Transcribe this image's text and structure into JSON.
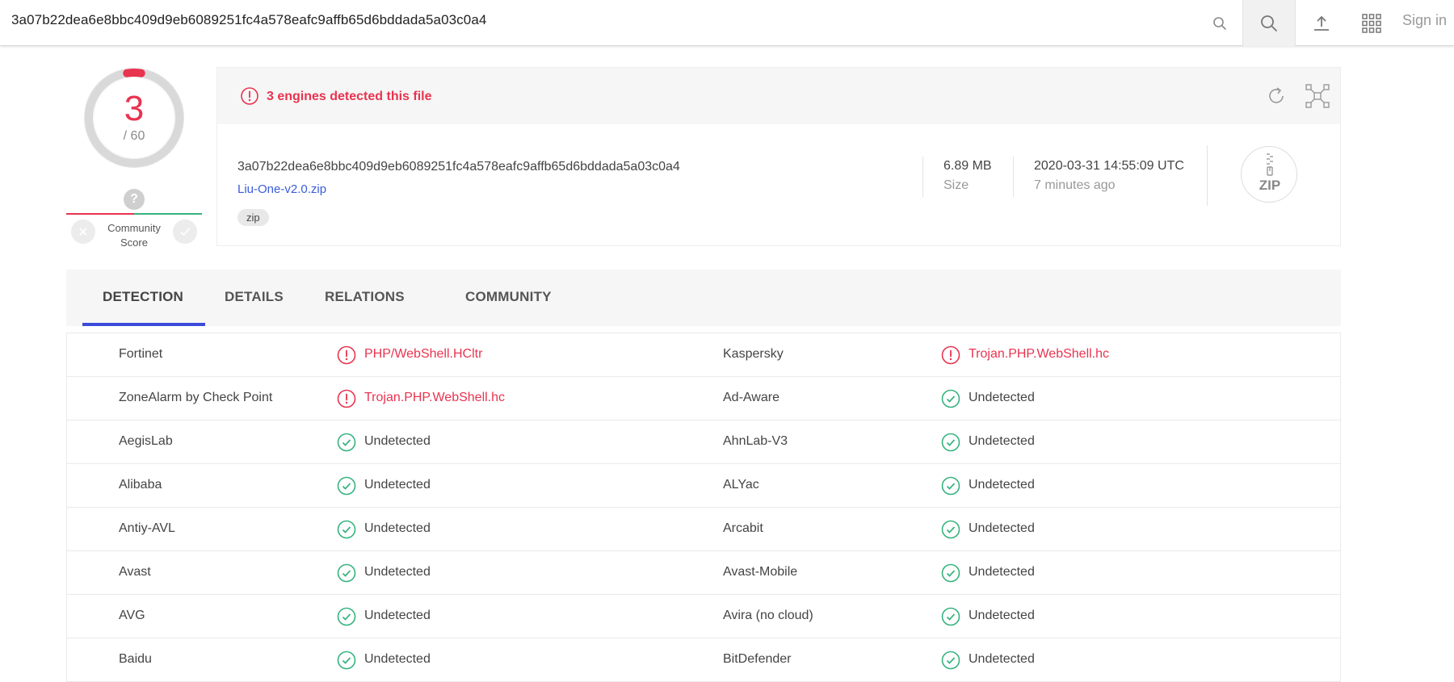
{
  "topbar": {
    "search_query": "3a07b22dea6e8bbc409d9eb6089251fc4a578eafc9affb65d6bddada5a03c0a4",
    "sign_in": "Sign in"
  },
  "score": {
    "detected": "3",
    "total": "/ 60",
    "ring_fraction": 0.05
  },
  "community": {
    "question": "?",
    "label_line1": "Community",
    "label_line2": "Score"
  },
  "banner": {
    "message": "3 engines detected this file"
  },
  "file": {
    "hash": "3a07b22dea6e8bbc409d9eb6089251fc4a578eafc9affb65d6bddada5a03c0a4",
    "name": "Liu-One-v2.0.zip",
    "tag": "zip",
    "size_value": "6.89 MB",
    "size_label": "Size",
    "date_value": "2020-03-31 14:55:09 UTC",
    "date_relative": "7 minutes ago",
    "type_badge": "ZIP"
  },
  "tabs": [
    {
      "label": "DETECTION",
      "active": true
    },
    {
      "label": "DETAILS",
      "active": false
    },
    {
      "label": "RELATIONS",
      "active": false
    },
    {
      "label": "COMMUNITY",
      "active": false
    }
  ],
  "detections": [
    {
      "left": {
        "engine": "Fortinet",
        "result": "PHP/WebShell.HCltr",
        "status": "malicious"
      },
      "right": {
        "engine": "Kaspersky",
        "result": "Trojan.PHP.WebShell.hc",
        "status": "malicious"
      }
    },
    {
      "left": {
        "engine": "ZoneAlarm by Check Point",
        "result": "Trojan.PHP.WebShell.hc",
        "status": "malicious"
      },
      "right": {
        "engine": "Ad-Aware",
        "result": "Undetected",
        "status": "clean"
      }
    },
    {
      "left": {
        "engine": "AegisLab",
        "result": "Undetected",
        "status": "clean"
      },
      "right": {
        "engine": "AhnLab-V3",
        "result": "Undetected",
        "status": "clean"
      }
    },
    {
      "left": {
        "engine": "Alibaba",
        "result": "Undetected",
        "status": "clean"
      },
      "right": {
        "engine": "ALYac",
        "result": "Undetected",
        "status": "clean"
      }
    },
    {
      "left": {
        "engine": "Antiy-AVL",
        "result": "Undetected",
        "status": "clean"
      },
      "right": {
        "engine": "Arcabit",
        "result": "Undetected",
        "status": "clean"
      }
    },
    {
      "left": {
        "engine": "Avast",
        "result": "Undetected",
        "status": "clean"
      },
      "right": {
        "engine": "Avast-Mobile",
        "result": "Undetected",
        "status": "clean"
      }
    },
    {
      "left": {
        "engine": "AVG",
        "result": "Undetected",
        "status": "clean"
      },
      "right": {
        "engine": "Avira (no cloud)",
        "result": "Undetected",
        "status": "clean"
      }
    },
    {
      "left": {
        "engine": "Baidu",
        "result": "Undetected",
        "status": "clean"
      },
      "right": {
        "engine": "BitDefender",
        "result": "Undetected",
        "status": "clean"
      }
    }
  ],
  "colors": {
    "malicious": "#e8344f",
    "clean": "#36b37e",
    "accent": "#3b4bdb"
  }
}
